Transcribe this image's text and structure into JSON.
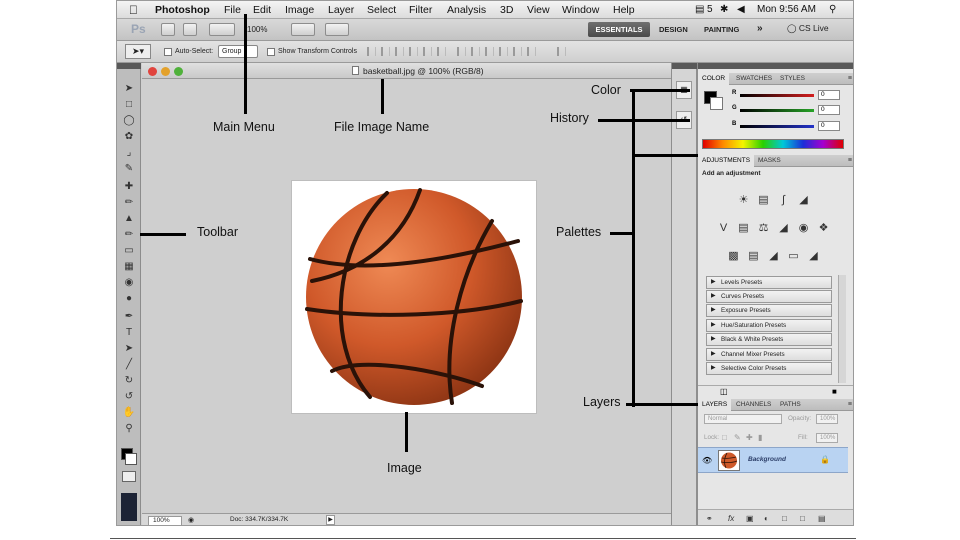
{
  "menubar": {
    "apple": "",
    "items": [
      "Photoshop",
      "File",
      "Edit",
      "Image",
      "Layer",
      "Select",
      "Filter",
      "Analysis",
      "3D",
      "View",
      "Window",
      "Help"
    ],
    "status": "5",
    "clock": "Mon 9:56 AM"
  },
  "appbar": {
    "logo": "Ps",
    "zoom": "100%",
    "workspaces": [
      "ESSENTIALS",
      "DESIGN",
      "PAINTING"
    ],
    "more": "»",
    "cs_live": "CS Live"
  },
  "options": {
    "auto_select_label": "Auto-Select:",
    "auto_select_value": "Group",
    "transform_label": "Show Transform Controls"
  },
  "document": {
    "title": "basketball.jpg @ 100% (RGB/8)",
    "zoom": "100%",
    "doc_info": "Doc: 334.7K/334.7K"
  },
  "color_panel": {
    "tabs": [
      "COLOR",
      "SWATCHES",
      "STYLES"
    ],
    "channels": [
      {
        "label": "R",
        "value": "0",
        "color": "#d21e1e"
      },
      {
        "label": "G",
        "value": "0",
        "color": "#27a327"
      },
      {
        "label": "B",
        "value": "0",
        "color": "#2433c8"
      }
    ]
  },
  "adjustments_panel": {
    "tabs": [
      "ADJUSTMENTS",
      "MASKS"
    ],
    "title": "Add an adjustment",
    "presets": [
      "Levels Presets",
      "Curves Presets",
      "Exposure Presets",
      "Hue/Saturation Presets",
      "Black & White Presets",
      "Channel Mixer Presets",
      "Selective Color Presets"
    ]
  },
  "layers_panel": {
    "tabs": [
      "LAYERS",
      "CHANNELS",
      "PATHS"
    ],
    "blend_mode": "Normal",
    "opacity_label": "Opacity:",
    "opacity": "100%",
    "lock_label": "Lock:",
    "fill_label": "Fill:",
    "fill": "100%",
    "layer_name": "Background"
  },
  "annotations": {
    "main_menu": "Main Menu",
    "file_image_name": "File Image Name",
    "toolbar": "Toolbar",
    "image": "Image",
    "color": "Color",
    "history": "History",
    "palettes": "Palettes",
    "layers": "Layers"
  },
  "accent": "#b9d3f2"
}
